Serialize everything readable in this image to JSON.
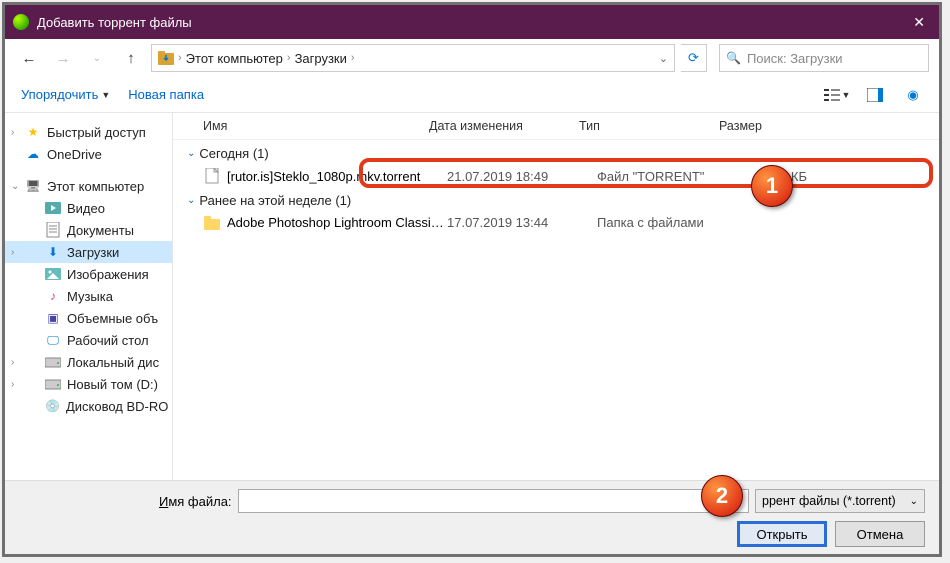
{
  "title": "Добавить торрент файлы",
  "breadcrumb": {
    "root": "Этот компьютер",
    "folder": "Загрузки"
  },
  "search_placeholder": "Поиск: Загрузки",
  "toolbar": {
    "organize": "Упорядочить",
    "new_folder": "Новая папка"
  },
  "sidebar": [
    {
      "label": "Быстрый доступ",
      "exp": true,
      "icon": "star",
      "level": 1
    },
    {
      "label": "OneDrive",
      "icon": "cloud",
      "level": 1
    },
    {
      "sep": true
    },
    {
      "label": "Этот компьютер",
      "exp": true,
      "open": true,
      "icon": "pc",
      "level": 1
    },
    {
      "label": "Видео",
      "icon": "video",
      "level": 2
    },
    {
      "label": "Документы",
      "icon": "doc",
      "level": 2
    },
    {
      "label": "Загрузки",
      "icon": "down",
      "level": 2,
      "selected": true,
      "exp_empty": true
    },
    {
      "label": "Изображения",
      "icon": "img",
      "level": 2
    },
    {
      "label": "Музыка",
      "icon": "music",
      "level": 2
    },
    {
      "label": "Объемные объ",
      "icon": "cube",
      "level": 2
    },
    {
      "label": "Рабочий стол",
      "icon": "desk",
      "level": 2
    },
    {
      "label": "Локальный дис",
      "icon": "drive",
      "level": 2,
      "exp_empty": true
    },
    {
      "label": "Новый том (D:)",
      "icon": "drive",
      "level": 2,
      "exp_empty": true
    },
    {
      "label": "Дисковод BD-RО",
      "icon": "bd",
      "level": 2
    }
  ],
  "columns": {
    "name": "Имя",
    "date": "Дата изменения",
    "type": "Тип",
    "size": "Размер"
  },
  "groups": [
    {
      "title": "Сегодня (1)",
      "rows": [
        {
          "icon": "file",
          "name": "[rutor.is]Steklo_1080p.mkv.torrent",
          "date": "21.07.2019 18:49",
          "type": "Файл \"TORRENT\"",
          "size": "68 КБ",
          "highlight": true
        }
      ]
    },
    {
      "title": "Ранее на этой неделе (1)",
      "rows": [
        {
          "icon": "folder",
          "name": "Adobe Photoshop Lightroom Classic CC ...",
          "date": "17.07.2019 13:44",
          "type": "Папка с файлами",
          "size": ""
        }
      ]
    }
  ],
  "filename_label": "Имя файла:",
  "filetype_label": "ррент файлы (*.torrent)",
  "buttons": {
    "open": "Открыть",
    "cancel": "Отмена"
  },
  "annotations": {
    "a1": "1",
    "a2": "2"
  }
}
